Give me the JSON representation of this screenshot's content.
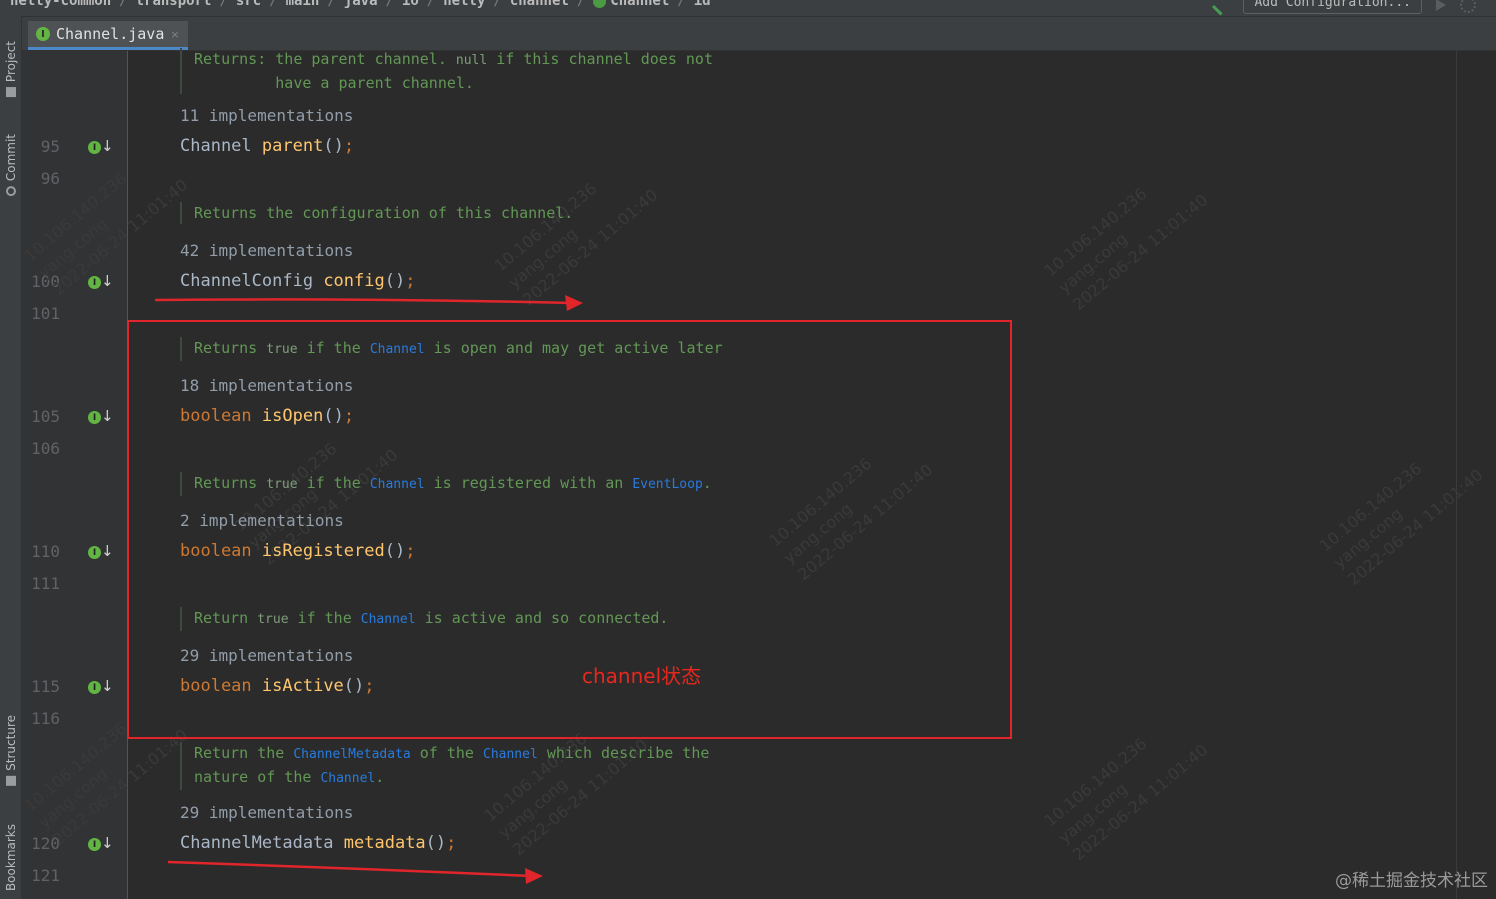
{
  "navbar": {
    "crumbs": [
      "netty-common",
      "transport",
      "src",
      "main",
      "java",
      "io",
      "netty",
      "channel",
      "Channel",
      "id"
    ],
    "add_configuration": "Add Configuration..."
  },
  "tool_windows": {
    "project": "Project",
    "commit": "Commit",
    "structure": "Structure",
    "bookmarks": "Bookmarks"
  },
  "tab": {
    "icon_letter": "I",
    "label": "Channel.java",
    "close": "×"
  },
  "gutter": {
    "line_numbers": [
      "95",
      "96",
      "100",
      "101",
      "105",
      "106",
      "110",
      "111",
      "115",
      "116",
      "120",
      "121"
    ],
    "impl_icon_letter": "I",
    "impl_arrow": "↓"
  },
  "editor": {
    "parent_doc": {
      "label": "Returns:",
      "text1": " the parent channel. ",
      "null": "null",
      "text2": " if this channel does not",
      "line2": "         have a parent channel."
    },
    "parent_impl": "11 implementations",
    "parent_code": {
      "type": "Channel",
      "method": "parent",
      "parens": "()",
      "semi": ";"
    },
    "config_doc": "Returns the configuration of this channel.",
    "config_impl": "42 implementations",
    "config_code": {
      "type": "ChannelConfig",
      "method": "config",
      "parens": "()",
      "semi": ";"
    },
    "isopen_doc": {
      "t1": "Returns ",
      "code1": "true",
      "t2": " if the ",
      "link1": "Channel",
      "t3": " is open and may get active later"
    },
    "isopen_impl": "18 implementations",
    "isopen_code": {
      "kw": "boolean",
      "method": "isOpen",
      "parens": "()",
      "semi": ";"
    },
    "isregistered_doc": {
      "t1": "Returns ",
      "code1": "true",
      "t2": " if the ",
      "link1": "Channel",
      "t3": " is registered with an ",
      "link2": "EventLoop",
      "t4": "."
    },
    "isregistered_impl": "2 implementations",
    "isregistered_code": {
      "kw": "boolean",
      "method": "isRegistered",
      "parens": "()",
      "semi": ";"
    },
    "isactive_doc": {
      "t1": "Return ",
      "code1": "true",
      "t2": " if the ",
      "link1": "Channel",
      "t3": " is active and so connected."
    },
    "isactive_impl": "29 implementations",
    "isactive_code": {
      "kw": "boolean",
      "method": "isActive",
      "parens": "()",
      "semi": ";"
    },
    "metadata_doc": {
      "t1": "Return the ",
      "link1": "ChannelMetadata",
      "t2": " of the ",
      "link2": "Channel",
      "t3": " which describe the",
      "t4": "nature of the ",
      "link3": "Channel",
      "t5": "."
    },
    "metadata_impl": "29 implementations",
    "metadata_code": {
      "type": "ChannelMetadata",
      "method": "metadata",
      "parens": "()",
      "semi": ";"
    }
  },
  "annotation": {
    "label": "channel状态",
    "color": "#e0252b"
  },
  "watermarks": {
    "text": "10.106.140.236\nyang.cong\n2022-06-24 11:01:40"
  },
  "site_watermark": "@稀土掘金技术社区"
}
